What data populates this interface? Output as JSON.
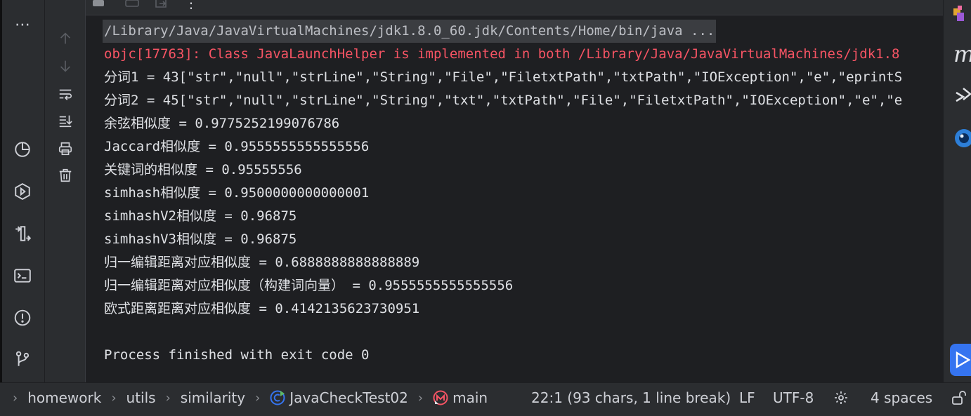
{
  "console": {
    "lines": [
      "/Library/Java/JavaVirtualMachines/jdk1.8.0_60.jdk/Contents/Home/bin/java ...",
      "objc[17763]: Class JavaLaunchHelper is implemented in both /Library/Java/JavaVirtualMachines/jdk1.8",
      "分词1 = 43[\"str\",\"null\",\"strLine\",\"String\",\"File\",\"FiletxtPath\",\"txtPath\",\"IOException\",\"e\",\"eprintS",
      "分词2 = 45[\"str\",\"null\",\"strLine\",\"String\",\"txt\",\"txtPath\",\"File\",\"FiletxtPath\",\"IOException\",\"e\",\"e",
      "余弦相似度 = 0.9775252199076786",
      "Jaccard相似度 = 0.9555555555555556",
      "关键词的相似度 = 0.95555556",
      "simhash相似度 = 0.9500000000000001",
      "simhashV2相似度 = 0.96875",
      "simhashV3相似度 = 0.96875",
      "归一编辑距离对应相似度 = 0.6888888888888889",
      "归一编辑距离对应相似度（构建词向量） = 0.9555555555555556",
      "欧式距离距离对应相似度 = 0.4142135623730951",
      "",
      "Process finished with exit code 0"
    ]
  },
  "toolstrip": {
    "more_label": "⋯"
  },
  "status": {
    "crumbs": [
      "homework",
      "utils",
      "similarity",
      "JavaCheckTest02",
      "main"
    ],
    "position": "22:1 (93 chars, 1 line break)",
    "line_ending": "LF",
    "encoding": "UTF-8",
    "indent": "4 spaces"
  },
  "colors": {
    "error": "#f75464",
    "accent": "#3574f0",
    "background": "#1e1f22",
    "panel": "#2b2d30"
  }
}
